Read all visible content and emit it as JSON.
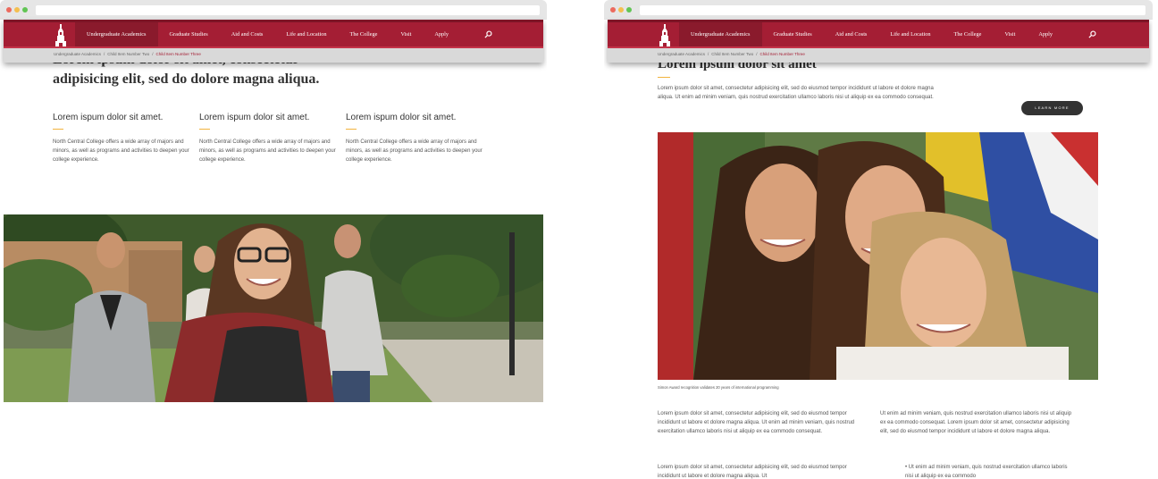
{
  "brand": {
    "primary": "#a41e34",
    "accent": "#f2b33d"
  },
  "nav": {
    "items": [
      "Undergraduate Academics",
      "Graduate Studies",
      "Aid and Costs",
      "Life and Location",
      "The College",
      "Visit",
      "Apply"
    ],
    "search_icon": "search-icon",
    "logo_icon": "college-tower-icon"
  },
  "breadcrumb": [
    "Undergraduate Academics",
    "Child Item Number Two",
    "Child Item Number Three"
  ],
  "left": {
    "hero_title": "Lorem ipsum dolor sit amet, consectetur adipisicing elit, sed do dolore magna aliqua.",
    "columns": [
      {
        "heading": "Lorem ispum dolor sit amet.",
        "text": "North Central College offers a wide array of majors and minors, as well as programs and activities to deepen your college experience."
      },
      {
        "heading": "Lorem ispum dolor sit amet.",
        "text": "North Central College offers a wide array of majors and minors, as well as programs and activities to deepen your college experience."
      },
      {
        "heading": "Lorem ispum dolor sit amet.",
        "text": "North Central College offers a wide array of majors and minors, as well as programs and activities to deepen your college experience."
      }
    ]
  },
  "right": {
    "hero_title": "Lorem ipsum dolor sit amet",
    "intro": "Lorem ipsum dolor sit amet, consectetur adipisicing elit, sed do eiusmod tempor incididunt ut labore et dolore magna aliqua. Ut enim ad minim veniam, quis nostrud exercitation ullamco laboris nisi ut aliquip ex ea commodo consequat.",
    "learn_more": "LEARN MORE",
    "caption": "Simon Award recognition validates 20 years of international programming",
    "body_left_1": "Lorem ipsum dolor sit amet, consectetur adipisicing elit, sed do eiusmod tempor incididunt ut labore et dolore magna aliqua. Ut enim ad minim veniam, quis nostrud exercitation ullamco laboris nisi ut aliquip ex ea commodo consequat.",
    "body_left_2": "Lorem ipsum dolor sit amet, consectetur adipisicing elit, sed do eiusmod tempor incididunt ut labore et dolore magna aliqua. Ut",
    "body_right_1": "Ut enim ad minim veniam, quis nostrud exercitation ullamco laboris nisi ut aliquip ex ea commodo consequat. Lorem ipsum dolor sit amet, consectetur adipisicing elit, sed do eiusmod tempor incididunt ut labore et dolore magna aliqua.",
    "bullet_1": "Ut enim ad minim veniam, quis nostrud exercitation ullamco laboris nisi ut aliquip ex ea commodo"
  }
}
